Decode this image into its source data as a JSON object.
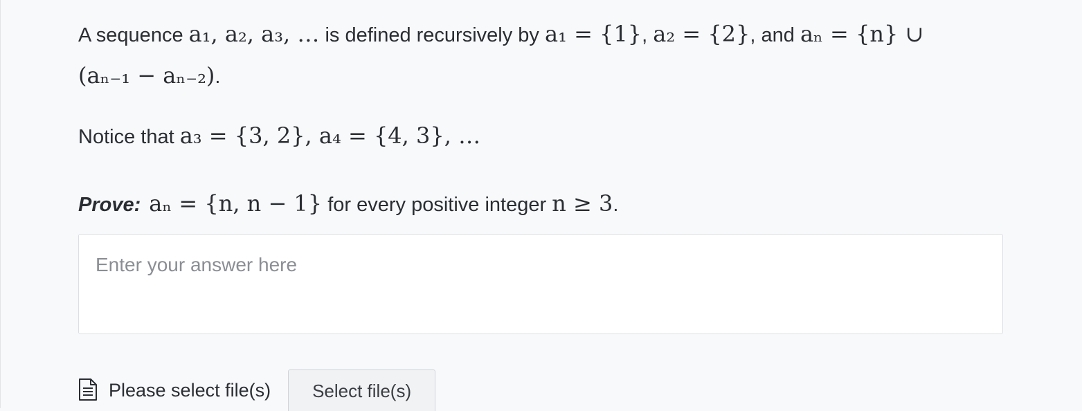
{
  "problem": {
    "intro_a": "A sequence ",
    "seq_terms": "a₁, a₂, a₃, …",
    "intro_b": " is defined recursively by ",
    "def_a1": "a₁ = {1}",
    "comma1": ", ",
    "def_a2": "a₂ = {2}",
    "and_text": ", and ",
    "def_an": "aₙ = {n} ∪",
    "def_an_cont": "(aₙ₋₁ − aₙ₋₂)",
    "period1": ".",
    "notice_prefix": "Notice that ",
    "notice_math": "a₃ = {3, 2}, a₄ = {4, 3}, …",
    "prove_label": "Prove:",
    "prove_math": "aₙ = {n, n − 1}",
    "prove_mid": " for every positive integer ",
    "prove_cond": "n ≥ 3",
    "period2": "."
  },
  "answer": {
    "placeholder": "Enter your answer here",
    "value": ""
  },
  "upload": {
    "status": "Please select file(s)",
    "button_label": "Select file(s)",
    "icon": "document-icon"
  },
  "colors": {
    "background": "#f8f9fb",
    "text": "#2a2d32",
    "placeholder": "#8a8e94",
    "border": "#dcdfe3"
  }
}
